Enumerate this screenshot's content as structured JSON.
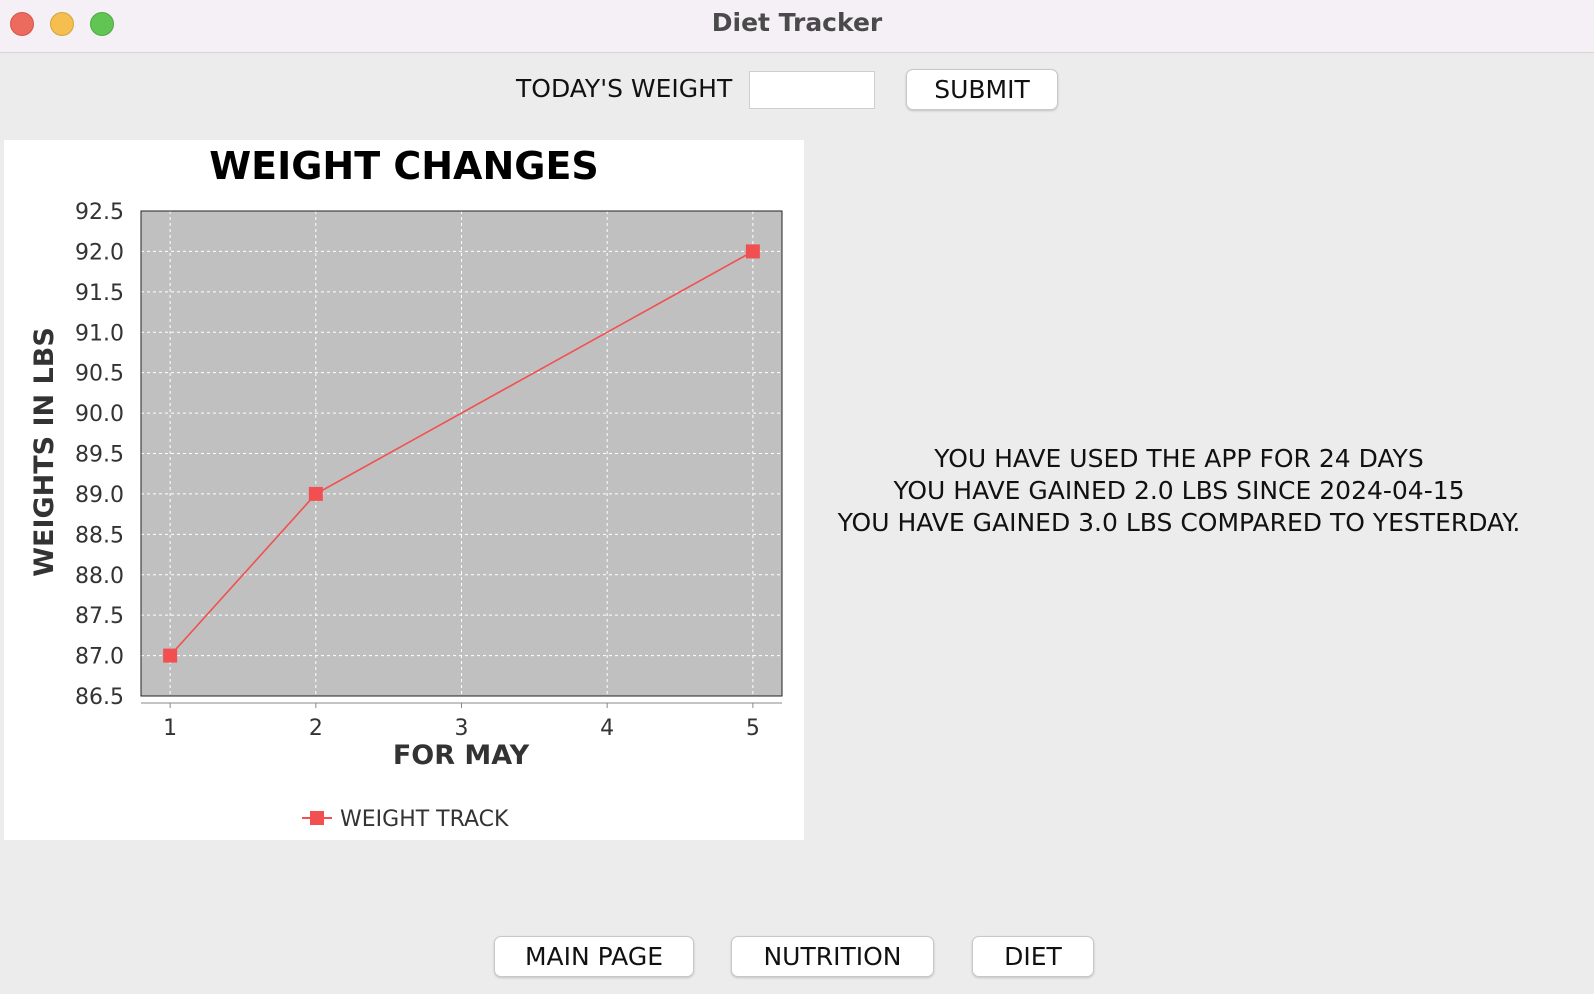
{
  "window": {
    "title": "Diet Tracker"
  },
  "weight_form": {
    "label": "TODAY'S WEIGHT",
    "input_value": "",
    "submit_label": "SUBMIT"
  },
  "info": {
    "line1": "YOU HAVE USED THE APP FOR 24 DAYS",
    "line2": "YOU HAVE GAINED 2.0 LBS SINCE 2024-04-15",
    "line3": "YOU HAVE GAINED 3.0 LBS COMPARED TO YESTERDAY."
  },
  "nav": {
    "main_page": "MAIN PAGE",
    "nutrition": "NUTRITION",
    "diet": "DIET"
  },
  "chart_data": {
    "type": "line",
    "title": "WEIGHT CHANGES",
    "xlabel": "FOR MAY",
    "ylabel": "WEIGHTS IN LBS",
    "xlim": [
      0.8,
      5.2
    ],
    "ylim": [
      86.5,
      92.5
    ],
    "x_ticks": [
      "1",
      "2",
      "3",
      "4",
      "5"
    ],
    "y_ticks": [
      "86.5",
      "87.0",
      "87.5",
      "88.0",
      "88.5",
      "89.0",
      "89.5",
      "90.0",
      "90.5",
      "91.0",
      "91.5",
      "92.0",
      "92.5"
    ],
    "grid": true,
    "legend": "bottom-center",
    "series": [
      {
        "name": "WEIGHT TRACK",
        "color": "#f25050",
        "points": [
          {
            "x": 1,
            "y": 87.0
          },
          {
            "x": 2,
            "y": 89.0
          },
          {
            "x": 5,
            "y": 92.0
          }
        ]
      }
    ],
    "plot_background": "#c0c0c0"
  }
}
